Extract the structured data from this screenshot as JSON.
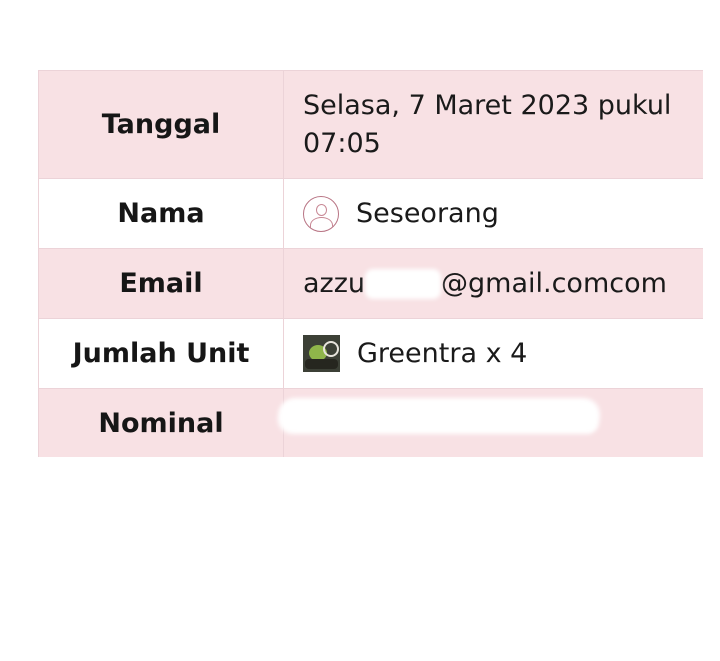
{
  "rows": [
    {
      "label": "Tanggal",
      "value": "Selasa, 7 Maret 2023 pukul 07:05"
    },
    {
      "label": "Nama",
      "value": "Seseorang",
      "icon": "user-avatar-icon"
    },
    {
      "label": "Email",
      "value_prefix": "azzu",
      "value_suffix": "@gmail.comcom"
    },
    {
      "label": "Jumlah Unit",
      "value": "Greentra x 4",
      "icon": "product-thumbnail"
    },
    {
      "label": "Nominal",
      "value": ""
    }
  ],
  "colors": {
    "row_pink": "#f8e1e4",
    "row_white": "#ffffff",
    "border": "#ecd3d8"
  }
}
